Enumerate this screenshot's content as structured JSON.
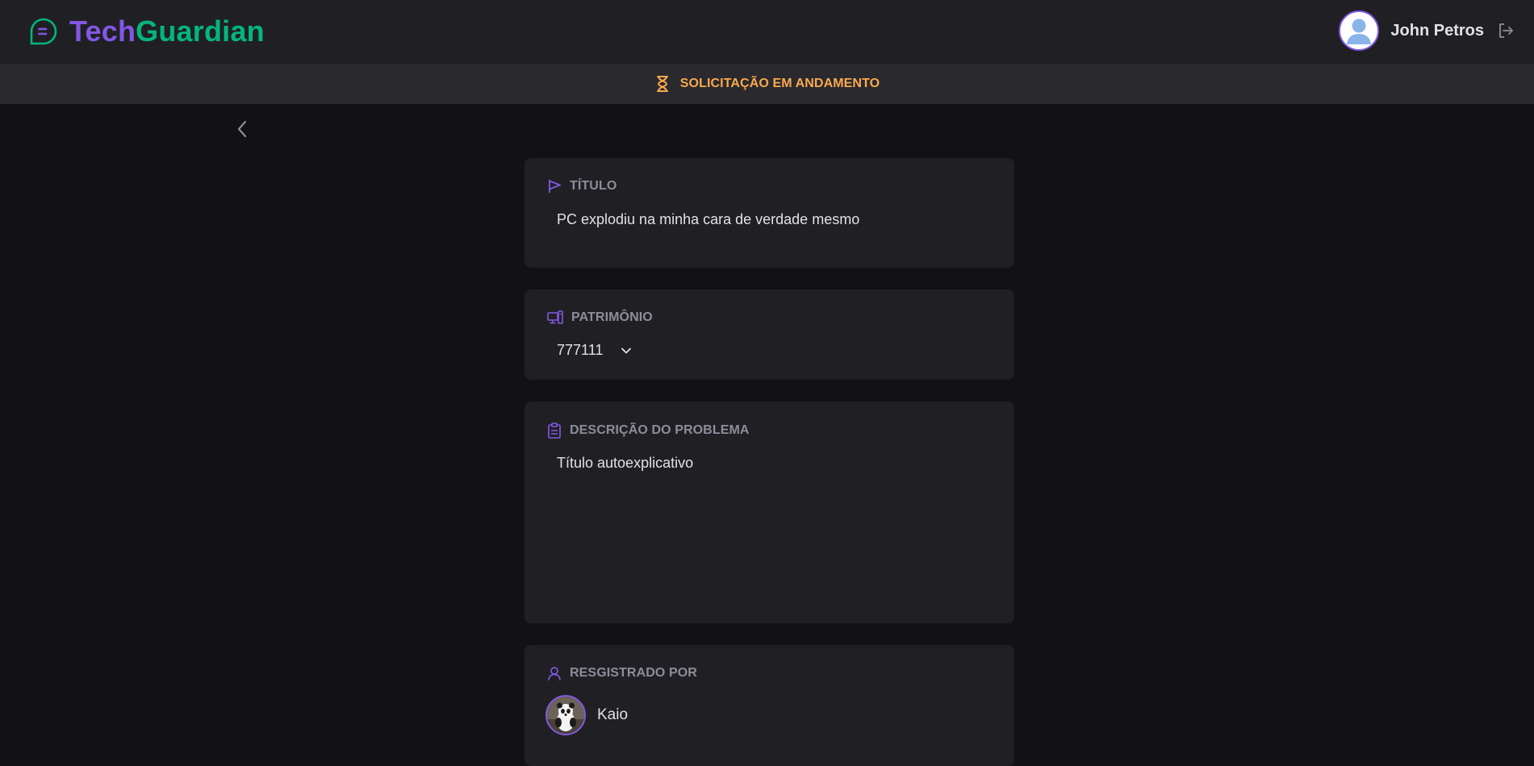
{
  "app": {
    "brand_part1": "Tech",
    "brand_part2": "Guardian",
    "brand_colors": {
      "tech": "#8257e5",
      "guardian": "#04b67b"
    }
  },
  "header": {
    "logo_icon": "chat-bubble-icon",
    "user_name": "John Petros",
    "user_avatar_icon": "user-avatar-icon",
    "logout_icon": "sign-out-icon"
  },
  "status": {
    "icon": "hourglass-icon",
    "text": "SOLICITAÇÃO EM ANDAMENTO",
    "color": "#fba94c"
  },
  "navigation": {
    "back_icon": "chevron-left-icon"
  },
  "sections": {
    "title": {
      "icon": "flag-icon",
      "label": "TÍTULO",
      "value": "PC explodiu na minha cara de verdade mesmo"
    },
    "asset": {
      "icon": "desktop-icon",
      "label": "PATRIMÔNIO",
      "value": "777111",
      "dropdown_icon": "chevron-down-icon"
    },
    "description": {
      "icon": "clipboard-icon",
      "label": "DESCRIÇÃO DO PROBLEMA",
      "value": "Título autoexplicativo"
    },
    "registered_by": {
      "icon": "user-icon",
      "label": "RESGISTRADO POR",
      "name": "Kaio",
      "avatar": "panda-avatar"
    }
  }
}
